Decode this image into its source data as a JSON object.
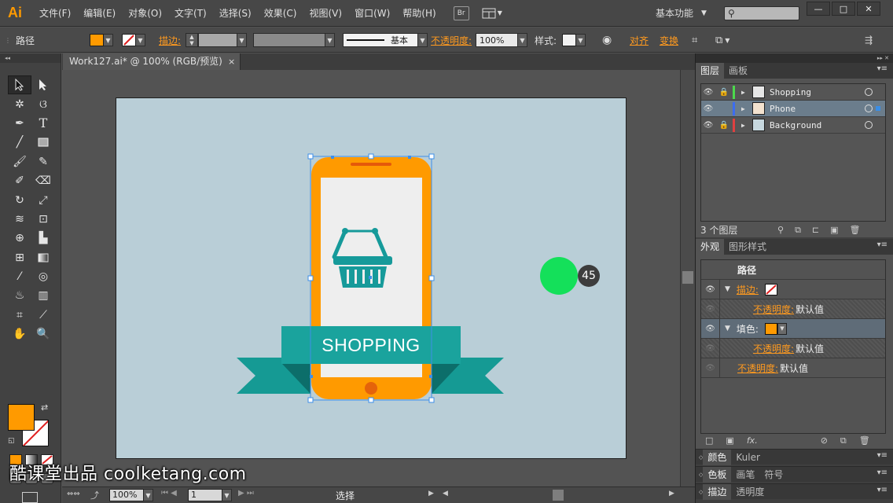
{
  "app": {
    "logo": "Ai"
  },
  "menu": [
    "文件(F)",
    "编辑(E)",
    "对象(O)",
    "文字(T)",
    "选择(S)",
    "效果(C)",
    "视图(V)",
    "窗口(W)",
    "帮助(H)"
  ],
  "bridge_label": "Br",
  "workspace": "基本功能",
  "control": {
    "selection_type": "路径",
    "stroke_label": "描边:",
    "stroke_profile": "基本",
    "opacity_label": "不透明度:",
    "opacity_value": "100%",
    "style_label": "样式:",
    "align_label": "对齐",
    "transform_label": "变换"
  },
  "document": {
    "tab_title": "Work127.ai* @ 100% (RGB/预览)",
    "close": "×"
  },
  "artwork": {
    "banner_text": "SHOPPING",
    "cursor_counter": "45"
  },
  "status": {
    "zoom": "100%",
    "page": "1",
    "mode": "选择"
  },
  "layers_panel": {
    "tabs": [
      "图层",
      "画板"
    ],
    "layers": [
      {
        "name": "Shopping",
        "color": "#4cd94c",
        "locked": true
      },
      {
        "name": "Phone",
        "color": "#3c6cf0",
        "locked": false,
        "selected": true
      },
      {
        "name": "Background",
        "color": "#e04040",
        "locked": true
      }
    ],
    "count_label": "3 个图层"
  },
  "appearance_panel": {
    "tabs": [
      "外观",
      "图形样式"
    ],
    "title": "路径",
    "rows": [
      {
        "kind": "stroke",
        "label": "描边:"
      },
      {
        "kind": "sub",
        "label": "不透明度:",
        "value": "默认值"
      },
      {
        "kind": "fill",
        "label": "填色:"
      },
      {
        "kind": "sub",
        "label": "不透明度:",
        "value": "默认值"
      },
      {
        "kind": "opacity",
        "label": "不透明度:",
        "value": "默认值"
      }
    ],
    "fx": "fx."
  },
  "collapsed_panels": [
    {
      "tabs": [
        "颜色",
        "Kuler"
      ]
    },
    {
      "tabs": [
        "色板",
        "画笔",
        "符号"
      ]
    },
    {
      "tabs": [
        "描边",
        "透明度"
      ]
    }
  ],
  "colors": {
    "fill": "#ff9a00",
    "phone_body": "#ff9a00",
    "teal": "#169a9a",
    "artboard_bg": "#b9ced7",
    "dot": "#14e05a"
  },
  "watermark": "酷课堂出品 coolketang.com"
}
